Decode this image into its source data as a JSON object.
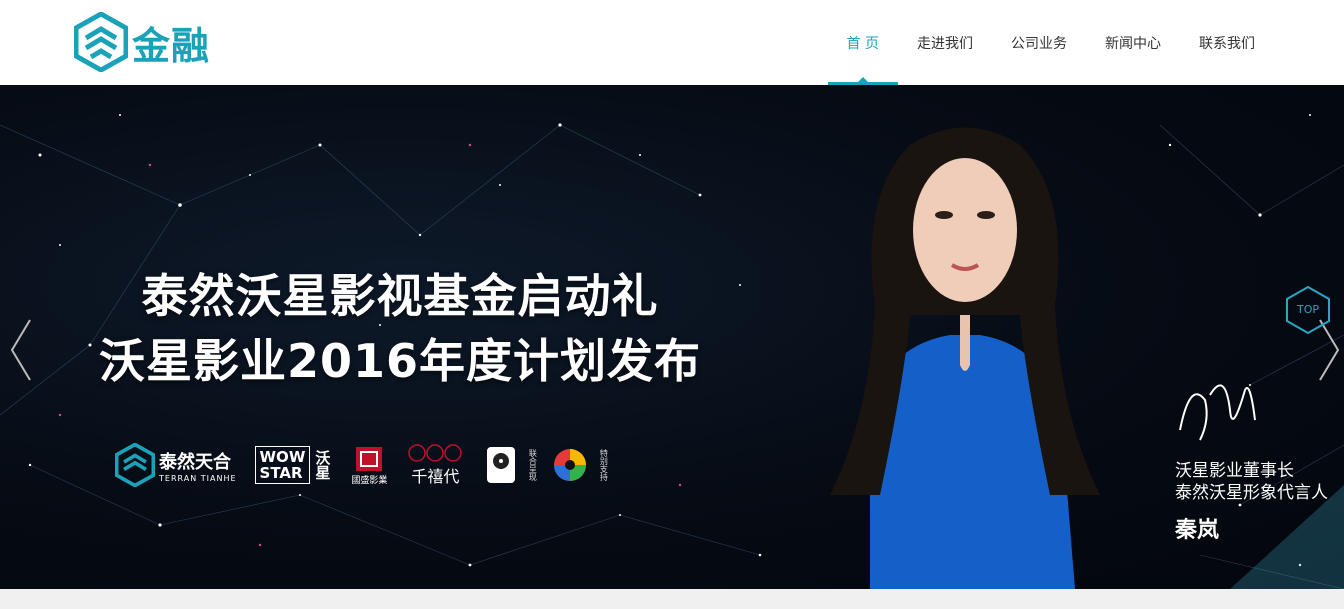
{
  "header": {
    "logo_text": "金融",
    "nav": [
      {
        "label": "首 页",
        "active": true
      },
      {
        "label": "走进我们",
        "active": false
      },
      {
        "label": "公司业务",
        "active": false
      },
      {
        "label": "新闻中心",
        "active": false
      },
      {
        "label": "联系我们",
        "active": false
      }
    ],
    "accent_color": "#1aa3b8"
  },
  "banner": {
    "headline_1": "泰然沃星影视基金启动礼",
    "headline_2": "沃星影业2016年度计划发布",
    "partners": {
      "terran_cn": "泰然天合",
      "terran_en": "TERRAN TIANHE",
      "wow_1": "WOW",
      "wow_2": "STAR",
      "wow_cn": "沃星",
      "guosheng_cn": "國盛影業",
      "qianxi_cn": "千禧代",
      "joint_label": "联合呈现",
      "special_label": "特别支持"
    },
    "caption": {
      "line_1": "沃星影业董事长",
      "line_2": "泰然沃星形象代言人",
      "name": "秦岚"
    },
    "top_button_label": "TOP"
  }
}
